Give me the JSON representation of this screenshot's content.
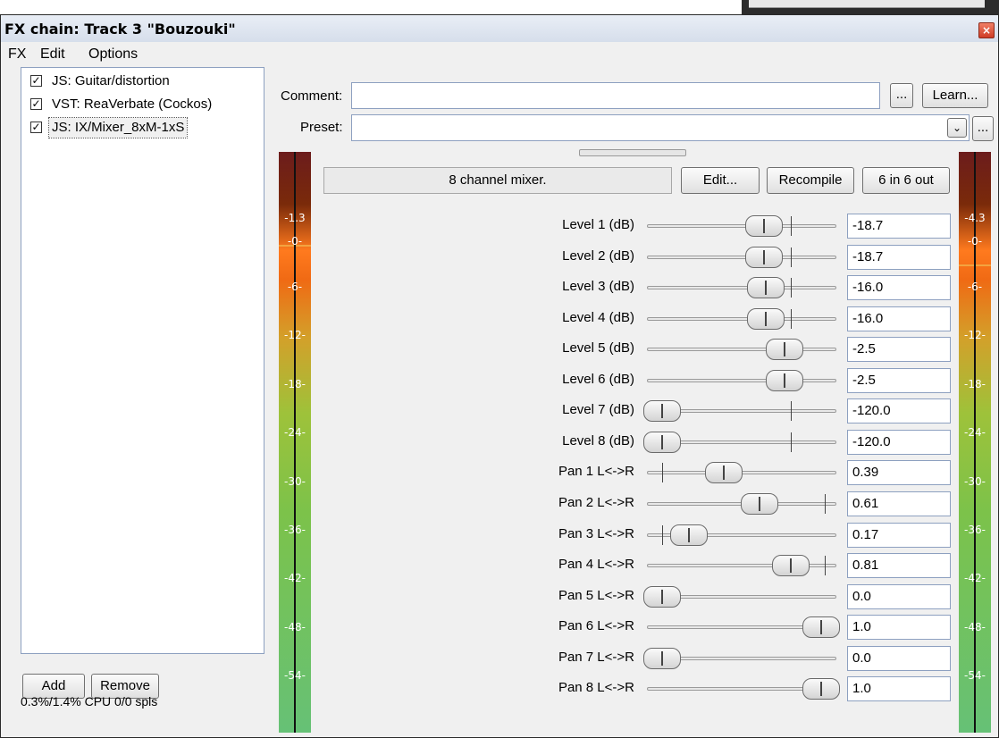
{
  "window": {
    "title": "FX chain: Track 3 \"Bouzouki\"",
    "close_glyph": "×"
  },
  "menu": [
    "FX",
    "Edit",
    "Options"
  ],
  "fx_chain": [
    {
      "label": "JS: Guitar/distortion",
      "checked": true
    },
    {
      "label": "VST: ReaVerbate (Cockos)",
      "checked": true
    },
    {
      "label": "JS: IX/Mixer_8xM-1xS",
      "checked": true,
      "selected": true
    }
  ],
  "list_buttons": {
    "add": "Add",
    "remove": "Remove"
  },
  "status": "0.3%/1.4% CPU 0/0 spls",
  "comment": {
    "label": "Comment:",
    "value": "",
    "browse_label": "...",
    "learn_label": "Learn..."
  },
  "preset": {
    "label": "Preset:",
    "value": "",
    "browse_label": "..."
  },
  "plugin": {
    "description": "8 channel mixer.",
    "edit_label": "Edit...",
    "recompile_label": "Recompile",
    "io_label": "6 in 6 out"
  },
  "meters": {
    "input_peak": "-1.3",
    "output_peak": "-4.3",
    "scale": [
      "-0-",
      "-6-",
      "-12-",
      "-18-",
      "-24-",
      "-30-",
      "-36-",
      "-42-",
      "-48-",
      "-54-"
    ]
  },
  "params": [
    {
      "label": "Level 1 (dB)",
      "value": "-18.7",
      "pos": 0.64,
      "default": 0.76
    },
    {
      "label": "Level 2 (dB)",
      "value": "-18.7",
      "pos": 0.64,
      "default": 0.76
    },
    {
      "label": "Level 3 (dB)",
      "value": "-16.0",
      "pos": 0.65,
      "default": 0.76
    },
    {
      "label": "Level 4 (dB)",
      "value": "-16.0",
      "pos": 0.65,
      "default": 0.76
    },
    {
      "label": "Level 5 (dB)",
      "value": "-2.5",
      "pos": 0.77,
      "default": 0.76
    },
    {
      "label": "Level 6 (dB)",
      "value": "-2.5",
      "pos": 0.77,
      "default": 0.76
    },
    {
      "label": "Level 7 (dB)",
      "value": "-120.0",
      "pos": 0.0,
      "default": 0.76
    },
    {
      "label": "Level 8 (dB)",
      "value": "-120.0",
      "pos": 0.0,
      "default": 0.76
    },
    {
      "label": "Pan 1 L<->R",
      "value": "0.39",
      "pos": 0.39,
      "default": 0.08
    },
    {
      "label": "Pan 2 L<->R",
      "value": "0.61",
      "pos": 0.61,
      "default": 0.94
    },
    {
      "label": "Pan 3 L<->R",
      "value": "0.17",
      "pos": 0.17,
      "default": 0.08
    },
    {
      "label": "Pan 4 L<->R",
      "value": "0.81",
      "pos": 0.81,
      "default": 0.94
    },
    {
      "label": "Pan 5 L<->R",
      "value": "0.0",
      "pos": 0.0
    },
    {
      "label": "Pan 6 L<->R",
      "value": "1.0",
      "pos": 1.0
    },
    {
      "label": "Pan 7 L<->R",
      "value": "0.0",
      "pos": 0.0
    },
    {
      "label": "Pan 8 L<->R",
      "value": "1.0",
      "pos": 1.0
    }
  ]
}
